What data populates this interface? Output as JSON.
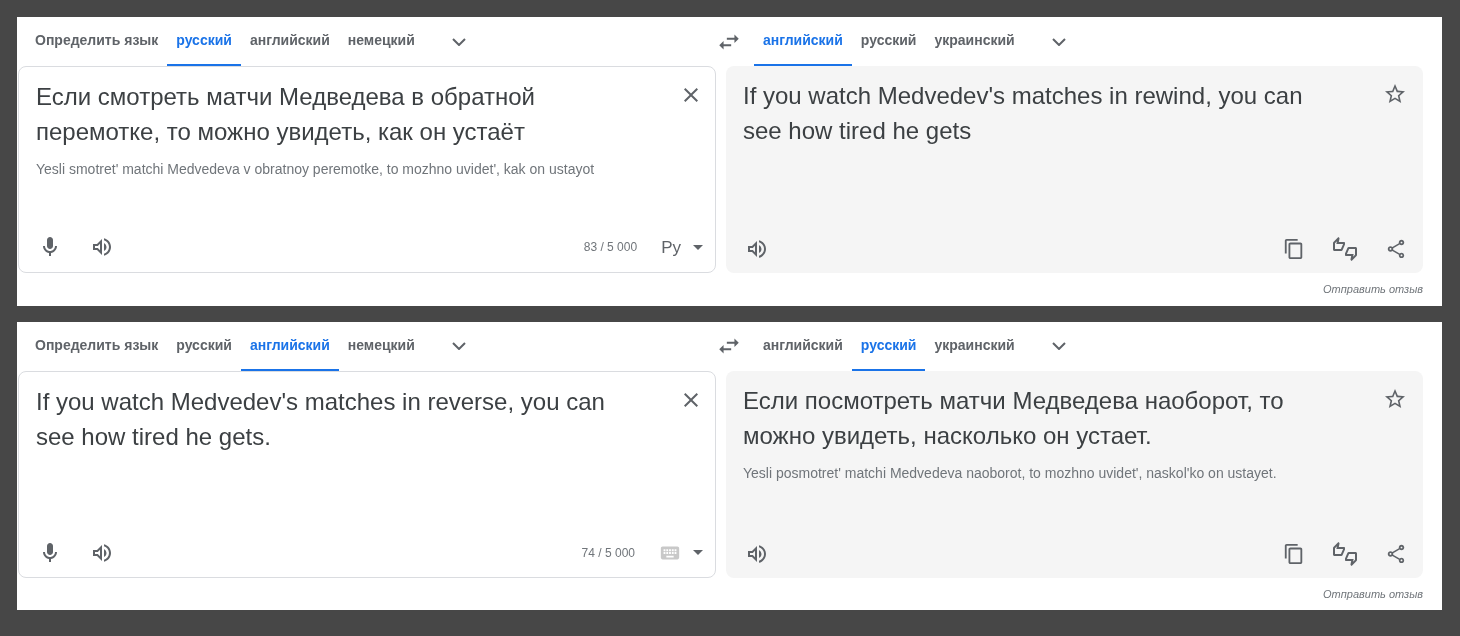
{
  "panels": [
    {
      "source": {
        "tabs": [
          {
            "label": "Определить язык",
            "selected": false
          },
          {
            "label": "русский",
            "selected": true
          },
          {
            "label": "английский",
            "selected": false
          },
          {
            "label": "немецкий",
            "selected": false
          }
        ],
        "text": "Если смотреть матчи Медведева в обратной перемотке, то можно увидеть, как он устаёт",
        "transliteration": "Yesli smotret' matchi Medvedeva v obratnoy peremotke, to mozhno uvidet', kak on ustayot",
        "char_count": "83 / 5 000",
        "input_tool": {
          "kind": "text",
          "label": "Ру"
        }
      },
      "target": {
        "tabs": [
          {
            "label": "английский",
            "selected": true
          },
          {
            "label": "русский",
            "selected": false
          },
          {
            "label": "украинский",
            "selected": false
          }
        ],
        "text": "If you watch Medvedev's matches in rewind, you can see how tired he gets"
      },
      "feedback_link": "Отправить отзыв"
    },
    {
      "source": {
        "tabs": [
          {
            "label": "Определить язык",
            "selected": false
          },
          {
            "label": "русский",
            "selected": false
          },
          {
            "label": "английский",
            "selected": true
          },
          {
            "label": "немецкий",
            "selected": false
          }
        ],
        "text": "If you watch Medvedev's matches in reverse, you can see how tired he gets.",
        "char_count": "74 / 5 000",
        "input_tool": {
          "kind": "keyboard"
        }
      },
      "target": {
        "tabs": [
          {
            "label": "английский",
            "selected": false
          },
          {
            "label": "русский",
            "selected": true
          },
          {
            "label": "украинский",
            "selected": false
          }
        ],
        "text": "Если посмотреть матчи Медведева наоборот, то можно увидеть, насколько он устает.",
        "transliteration": "Yesli posmotret' matchi Medvedeva naoborot, to mozhno uvidet', naskol'ko on ustayet."
      },
      "feedback_link": "Отправить отзыв"
    }
  ]
}
